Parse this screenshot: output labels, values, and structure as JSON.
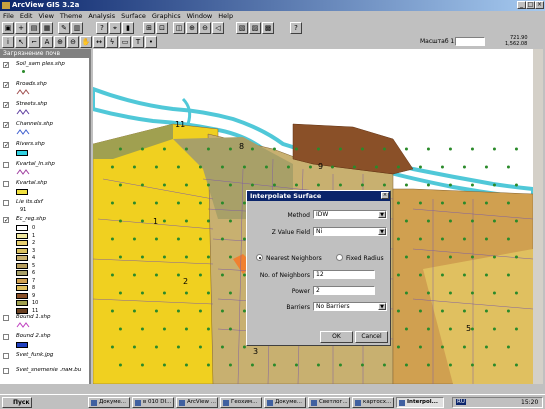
{
  "window": {
    "title": "ArcView GIS 3.2a"
  },
  "menu": [
    "File",
    "Edit",
    "View",
    "Theme",
    "Analysis",
    "Surface",
    "Graphics",
    "Window",
    "Help"
  ],
  "scale": {
    "label": "Масштаб 1:",
    "value": "",
    "coord_x": "721.90",
    "coord_y": "1,562.08"
  },
  "toc": {
    "header": "Загрязнение почв",
    "layers": [
      {
        "name": "Soil_sam ples.shp",
        "checked": true
      },
      {
        "name": "Rroads.shp",
        "checked": true
      },
      {
        "name": "Streets.shp",
        "checked": true
      },
      {
        "name": "Channels.shp",
        "checked": true
      },
      {
        "name": "Rivers.shp",
        "checked": true
      },
      {
        "name": "Kvartal_ln.shp",
        "checked": false
      },
      {
        "name": "Kvartal.shp",
        "checked": false
      },
      {
        "name": "Lie its.dxf",
        "checked": false
      },
      {
        "name": "Ec_reg.shp",
        "checked": true
      },
      {
        "name": "Bound 1.shp",
        "checked": false
      },
      {
        "name": "Bound 2.shp",
        "checked": false
      },
      {
        "name": "Svet_funk.jpg",
        "checked": false
      },
      {
        "name": "Svet_snemenie .пам.bu",
        "checked": false
      }
    ],
    "lie_value": "91",
    "legend": [
      "0",
      "1",
      "2",
      "3",
      "4",
      "5",
      "6",
      "7",
      "8",
      "9",
      "10",
      "11"
    ]
  },
  "map_labels": [
    "11",
    "8",
    "9",
    "1",
    "2",
    "3",
    "5"
  ],
  "dialog": {
    "title": "Interpolate Surface",
    "method_label": "Method",
    "method_value": "IDW",
    "zfield_label": "Z Value Field",
    "zfield_value": "Ni",
    "nearest_label": "Nearest Neighbors",
    "fixed_label": "Fixed Radius",
    "neighbors_label": "No. of Neighbors",
    "neighbors_value": "12",
    "power_label": "Power",
    "power_value": "2",
    "barriers_label": "Barriers",
    "barriers_value": "No Barriers",
    "ok": "OK",
    "cancel": "Cancel"
  },
  "taskbar": {
    "start": "Пуск",
    "tasks": [
      "Докуме...",
      "в 010 DI...",
      "ArcView ...",
      "Геохим...",
      "Докуме...",
      "Светлог...",
      "картосх...",
      "Interpol..."
    ],
    "lang": "RU",
    "clock": "15:20"
  }
}
